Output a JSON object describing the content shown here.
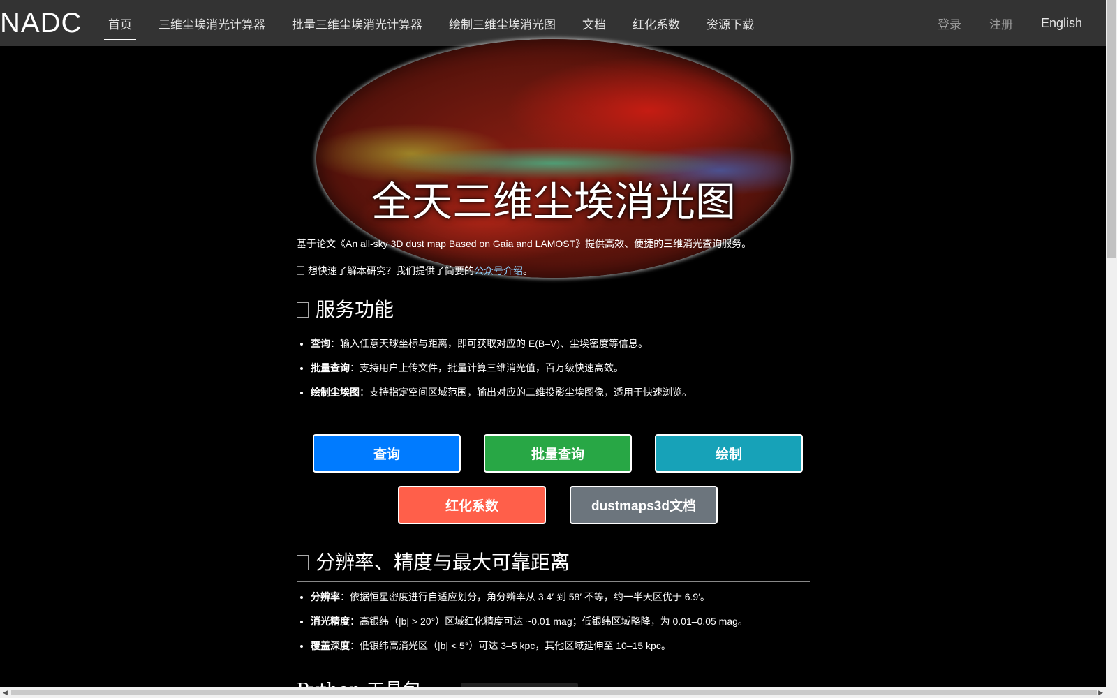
{
  "nav": {
    "brand": "NADC",
    "links": [
      "首页",
      "三维尘埃消光计算器",
      "批量三维尘埃消光计算器",
      "绘制三维尘埃消光图",
      "文档",
      "红化系数",
      "资源下载"
    ],
    "login": "登录",
    "register": "注册",
    "language": "English"
  },
  "hero": {
    "title": "全天三维尘埃消光图"
  },
  "intro": {
    "text": "基于论文《An all-sky 3D dust map Based on Gaia and LAMOST》提供高效、便捷的三维消光查询服务。",
    "tip_text": "想快速了解本研究？我们提供了简要的",
    "tip_link": "公众号介绍",
    "tip_end": "。"
  },
  "services": {
    "title": "服务功能",
    "items": [
      {
        "label": "查询",
        "text": "：输入任意天球坐标与距离，即可获取对应的 E(B–V)、尘埃密度等信息。"
      },
      {
        "label": "批量查询",
        "text": "：支持用户上传文件，批量计算三维消光值，百万级快速高效。"
      },
      {
        "label": "绘制尘埃图",
        "text": "：支持指定空间区域范围，输出对应的二维投影尘埃图像，适用于快速浏览。"
      }
    ]
  },
  "buttons": {
    "query": "查询",
    "batch": "批量查询",
    "plot": "绘制",
    "reddening": "红化系数",
    "docs": "dustmaps3d文档"
  },
  "colors": {
    "query": "#007bff",
    "batch": "#28a745",
    "plot": "#17a2b8",
    "reddening": "#ff5f4a",
    "docs": "#6c757d"
  },
  "resolution": {
    "title": "分辨率、精度与最大可靠距离",
    "items": [
      {
        "label": "分辨率",
        "text": "：依据恒星密度进行自适应划分，角分辨率从 3.4′ 到 58′ 不等，约一半天区优于 6.9′。"
      },
      {
        "label": "消光精度",
        "text": "：高银纬（|b| > 20°）区域红化精度可达 ~0.01 mag；低银纬区域略降，为 0.01–0.05 mag。"
      },
      {
        "label": "覆盖深度",
        "text": "：低银纬高消光区（|b| < 5°）可达 3–5 kpc，其他区域延伸至 10–15 kpc。"
      }
    ]
  },
  "next_section": {
    "title_partial": "Python 工具包"
  }
}
